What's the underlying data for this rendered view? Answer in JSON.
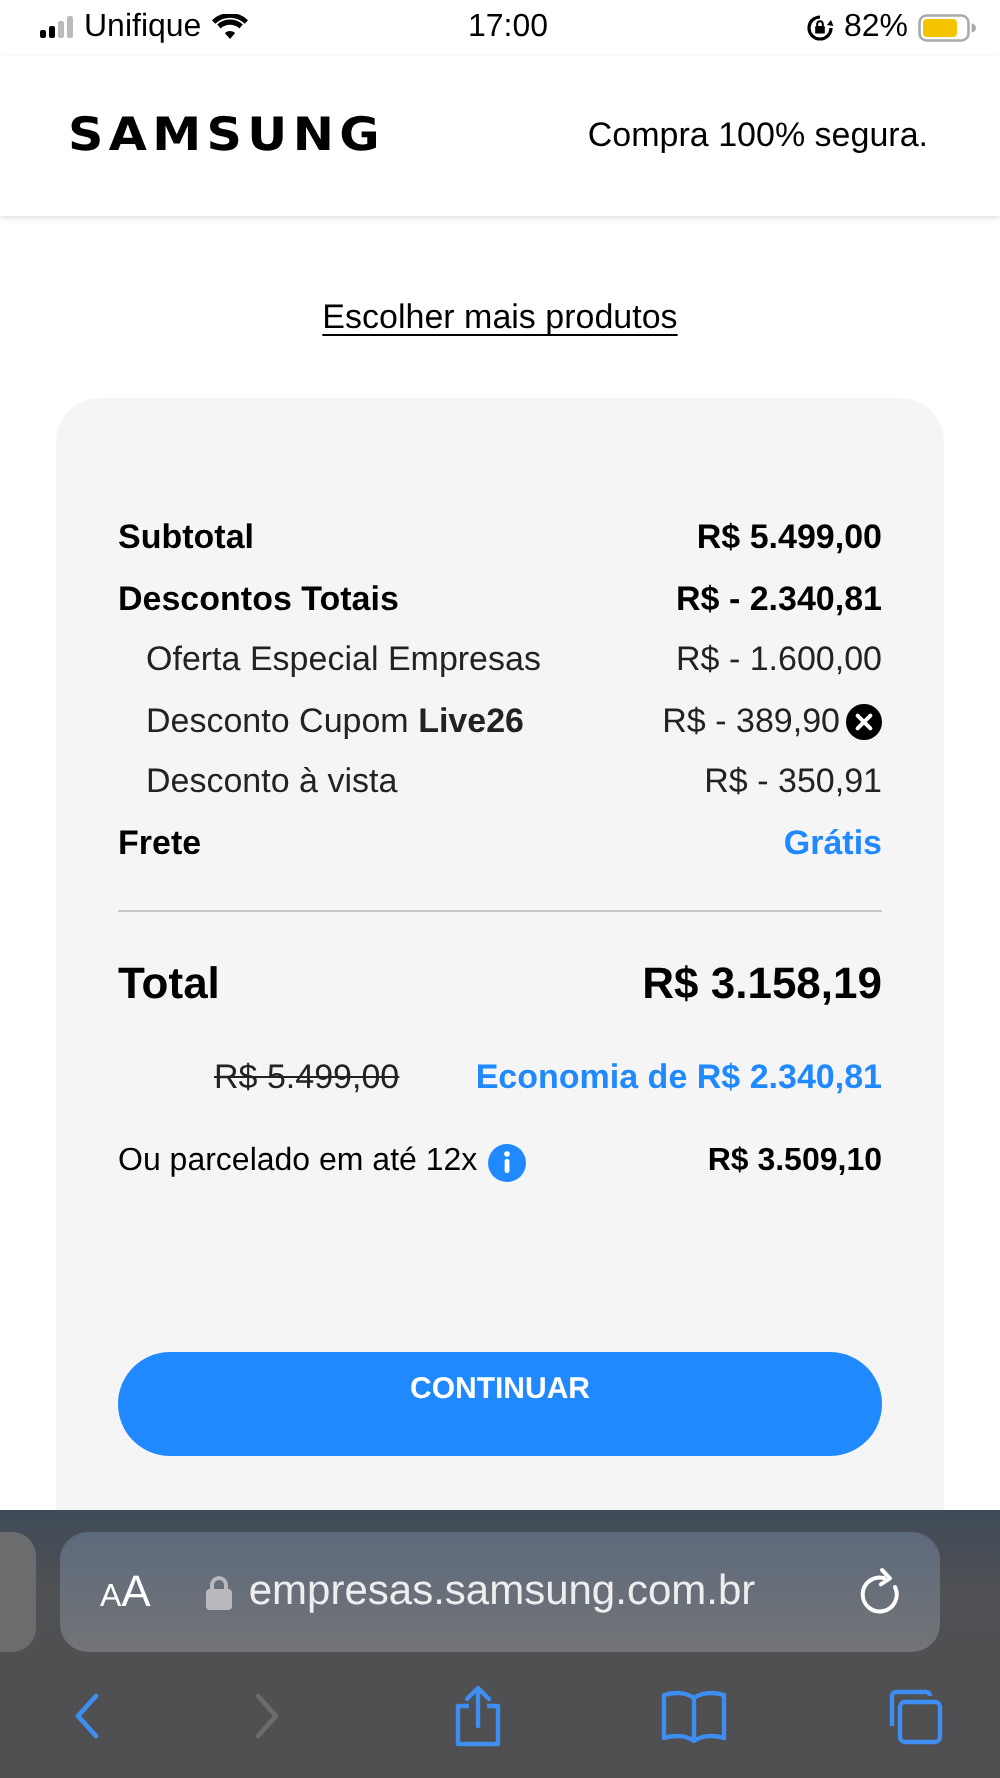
{
  "status_bar": {
    "carrier": "Unifique",
    "time": "17:00",
    "battery": "82%"
  },
  "header": {
    "logo": "SAMSUNG",
    "tagline": "Compra 100% segura."
  },
  "link": "Escolher mais produtos",
  "summary": {
    "rows": [
      {
        "kind": "main",
        "label": "Subtotal",
        "value": "R$ 5.499,00",
        "removable": false
      },
      {
        "kind": "main",
        "label": "Descontos Totais",
        "value": "R$ - 2.340,81",
        "removable": false
      },
      {
        "kind": "sub",
        "label": "Oferta Especial Empresas",
        "value": "R$ - 1.600,00",
        "removable": false
      },
      {
        "kind": "sub",
        "label": "Desconto Cupom **Live26**",
        "value": "R$ - 389,90",
        "removable": true
      },
      {
        "kind": "sub",
        "label": "Desconto à vista",
        "value": "R$ - 350,91",
        "removable": false
      },
      {
        "kind": "shipping",
        "label": "Frete",
        "value": "Grátis",
        "removable": false
      }
    ],
    "total": {
      "label": "Total",
      "value": "R$ 3.158,19"
    },
    "old_price": "R$ 5.499,00",
    "savings": "Economia de R$ 2.340,81",
    "installments": {
      "label": "Ou parcelado em até 12x",
      "value": "R$ 3.509,10"
    },
    "button": "CONTINUAR"
  },
  "browser": {
    "text_size": "AA",
    "url": "empresas.samsung.com.br",
    "nav": [
      {
        "kind": "back",
        "disabled": false
      },
      {
        "kind": "forward",
        "disabled": true
      }
    ]
  }
}
